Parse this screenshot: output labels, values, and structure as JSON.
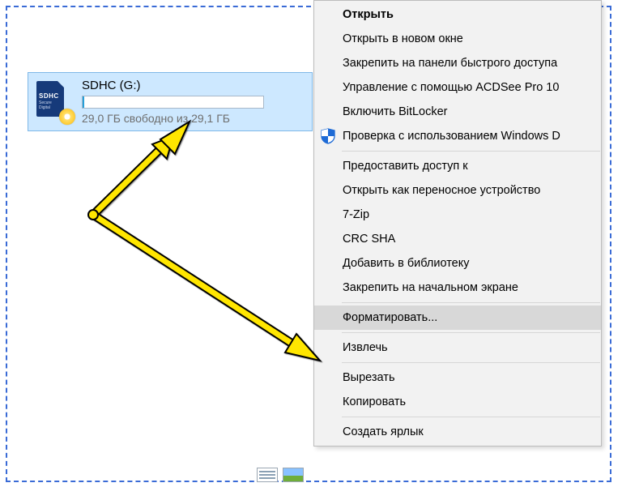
{
  "drive": {
    "label": "SDHC (G:)",
    "icon_text": "SDHC",
    "icon_sub": "Secure Digital",
    "free_text": "29,0 ГБ свободно из 29,1 ГБ"
  },
  "context_menu": {
    "groups": [
      [
        {
          "label": "Открыть",
          "bold": true
        },
        {
          "label": "Открыть в новом окне"
        },
        {
          "label": "Закрепить на панели быстрого доступа"
        },
        {
          "label": "Управление с помощью ACDSee Pro 10"
        },
        {
          "label": "Включить BitLocker"
        },
        {
          "label": "Проверка с использованием Windows D",
          "icon": "shield"
        }
      ],
      [
        {
          "label": "Предоставить доступ к"
        },
        {
          "label": "Открыть как переносное устройство"
        },
        {
          "label": "7-Zip"
        },
        {
          "label": "CRC SHA"
        },
        {
          "label": "Добавить в библиотеку"
        },
        {
          "label": "Закрепить на начальном экране"
        }
      ],
      [
        {
          "label": "Форматировать...",
          "hover": true
        }
      ],
      [
        {
          "label": "Извлечь"
        }
      ],
      [
        {
          "label": "Вырезать"
        },
        {
          "label": "Копировать"
        }
      ],
      [
        {
          "label": "Создать ярлык"
        }
      ]
    ]
  },
  "annotation": {
    "arrow_color": "#ffe600",
    "arrow_stroke": "#000000"
  }
}
